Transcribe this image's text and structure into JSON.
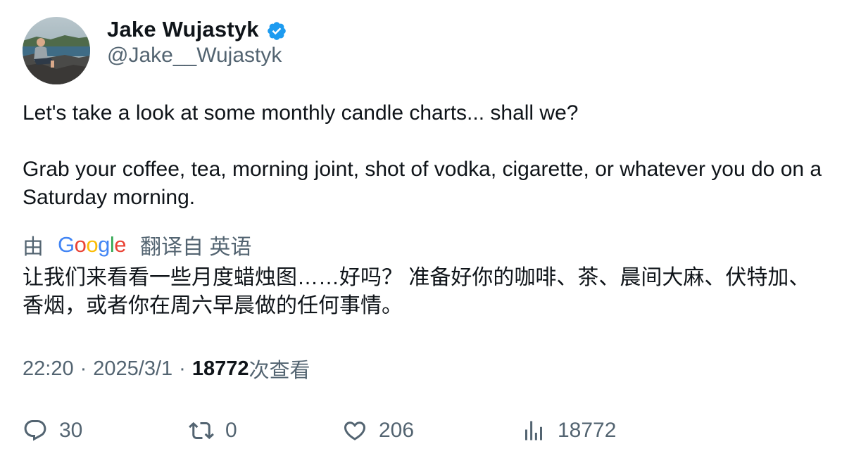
{
  "author": {
    "display_name": "Jake Wujastyk",
    "handle": "@Jake__Wujastyk",
    "verified": true,
    "verified_color": "#1d9bf0"
  },
  "tweet": {
    "paragraph_1": "Let's take a look at some monthly candle charts... shall we?",
    "paragraph_2": "Grab your coffee, tea, morning joint, shot of vodka, cigarette, or whatever you do on a Saturday morning."
  },
  "translation": {
    "prefix": "由",
    "provider": "Google",
    "suffix": "翻译自 英语",
    "text": "让我们来看看一些月度蜡烛图……好吗？ 准备好你的咖啡、茶、晨间大麻、伏特加、香烟，或者你在周六早晨做的任何事情。"
  },
  "meta": {
    "time": "22:20",
    "separator": "·",
    "date": "2025/3/1",
    "views_count": "18772",
    "views_label": "次查看"
  },
  "actions": {
    "replies": "30",
    "reposts": "0",
    "likes": "206",
    "views": "18772"
  },
  "colors": {
    "text_primary": "#0f1419",
    "text_secondary": "#536471",
    "google_blue": "#4285f4",
    "google_red": "#ea4335",
    "google_yellow": "#fbbc05",
    "google_green": "#34a853"
  }
}
